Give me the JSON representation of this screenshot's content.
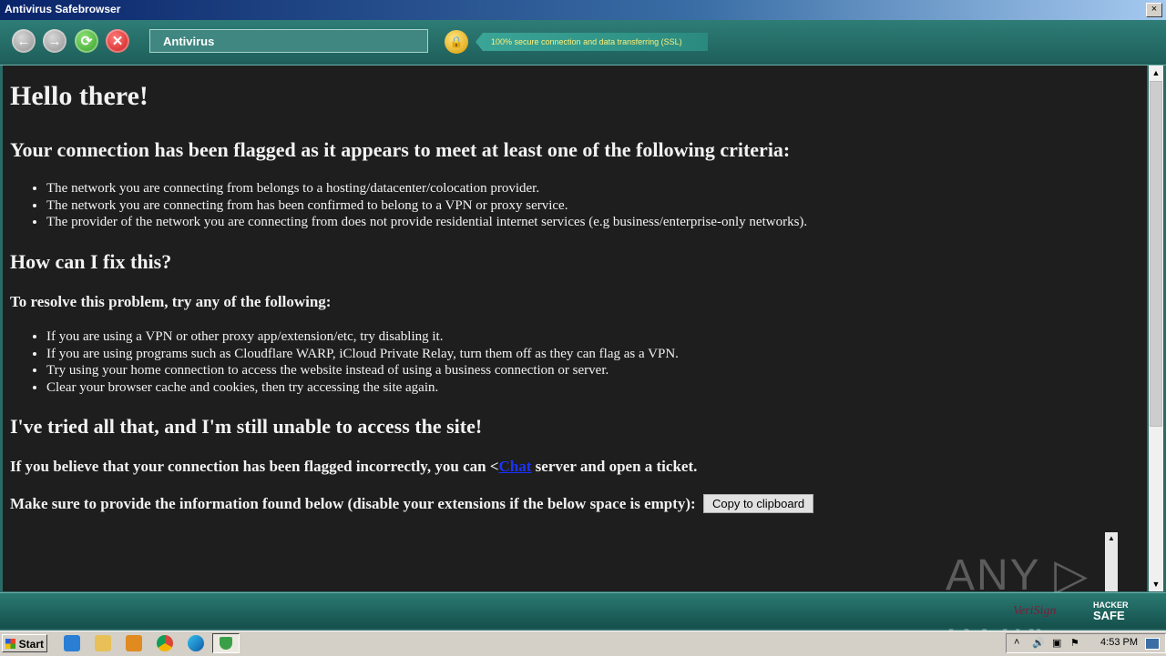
{
  "window": {
    "title": "Antivirus Safebrowser",
    "close_label": "×"
  },
  "toolbar": {
    "back_glyph": "←",
    "forward_glyph": "→",
    "refresh_glyph": "⟳",
    "stop_glyph": "✕",
    "address_value": "Antivirus",
    "ssl_text": "100% secure connection and data transferring (SSL)"
  },
  "page": {
    "heading": "Hello there!",
    "flag_heading": "Your connection has been flagged as it appears to meet at least one of the following criteria:",
    "criteria": [
      "The network you are connecting from belongs to a hosting/datacenter/colocation provider.",
      "The network you are connecting from has been confirmed to belong to a VPN or proxy service.",
      "The provider of the network you are connecting from does not provide residential internet services (e.g business/enterprise-only networks)."
    ],
    "fix_heading": "How can I fix this?",
    "fix_subheading": "To resolve this problem, try any of the following:",
    "fixes": [
      "If you are using a VPN or other proxy app/extension/etc, try disabling it.",
      "If you are using programs such as Cloudflare WARP, iCloud Private Relay, turn them off as they can flag as a VPN.",
      "Try using your home connection to access the website instead of using a business connection or server.",
      "Clear your browser cache and cookies, then try accessing the site again."
    ],
    "tried_heading": "I've tried all that, and I'm still unable to access the site!",
    "contact_before": "If you believe that your connection has been flagged incorrectly, you can <",
    "contact_link": "Chat",
    "contact_after": " server and open a ticket.",
    "info_text": "Make sure to provide the information found below (disable your extensions if the below space is empty):",
    "copy_button": "Copy to clipboard"
  },
  "footer": {
    "verisign": "VeriSign",
    "hacker_line1": "HACKER",
    "hacker_line2": "SAFE"
  },
  "watermark": "ANY ▷ RUN",
  "taskbar": {
    "start_label": "Start",
    "clock": "4:53 PM"
  },
  "colors": {
    "toolbar": "#1e5e5a",
    "content_bg": "#1e1e1e",
    "link": "#1a33ff"
  }
}
